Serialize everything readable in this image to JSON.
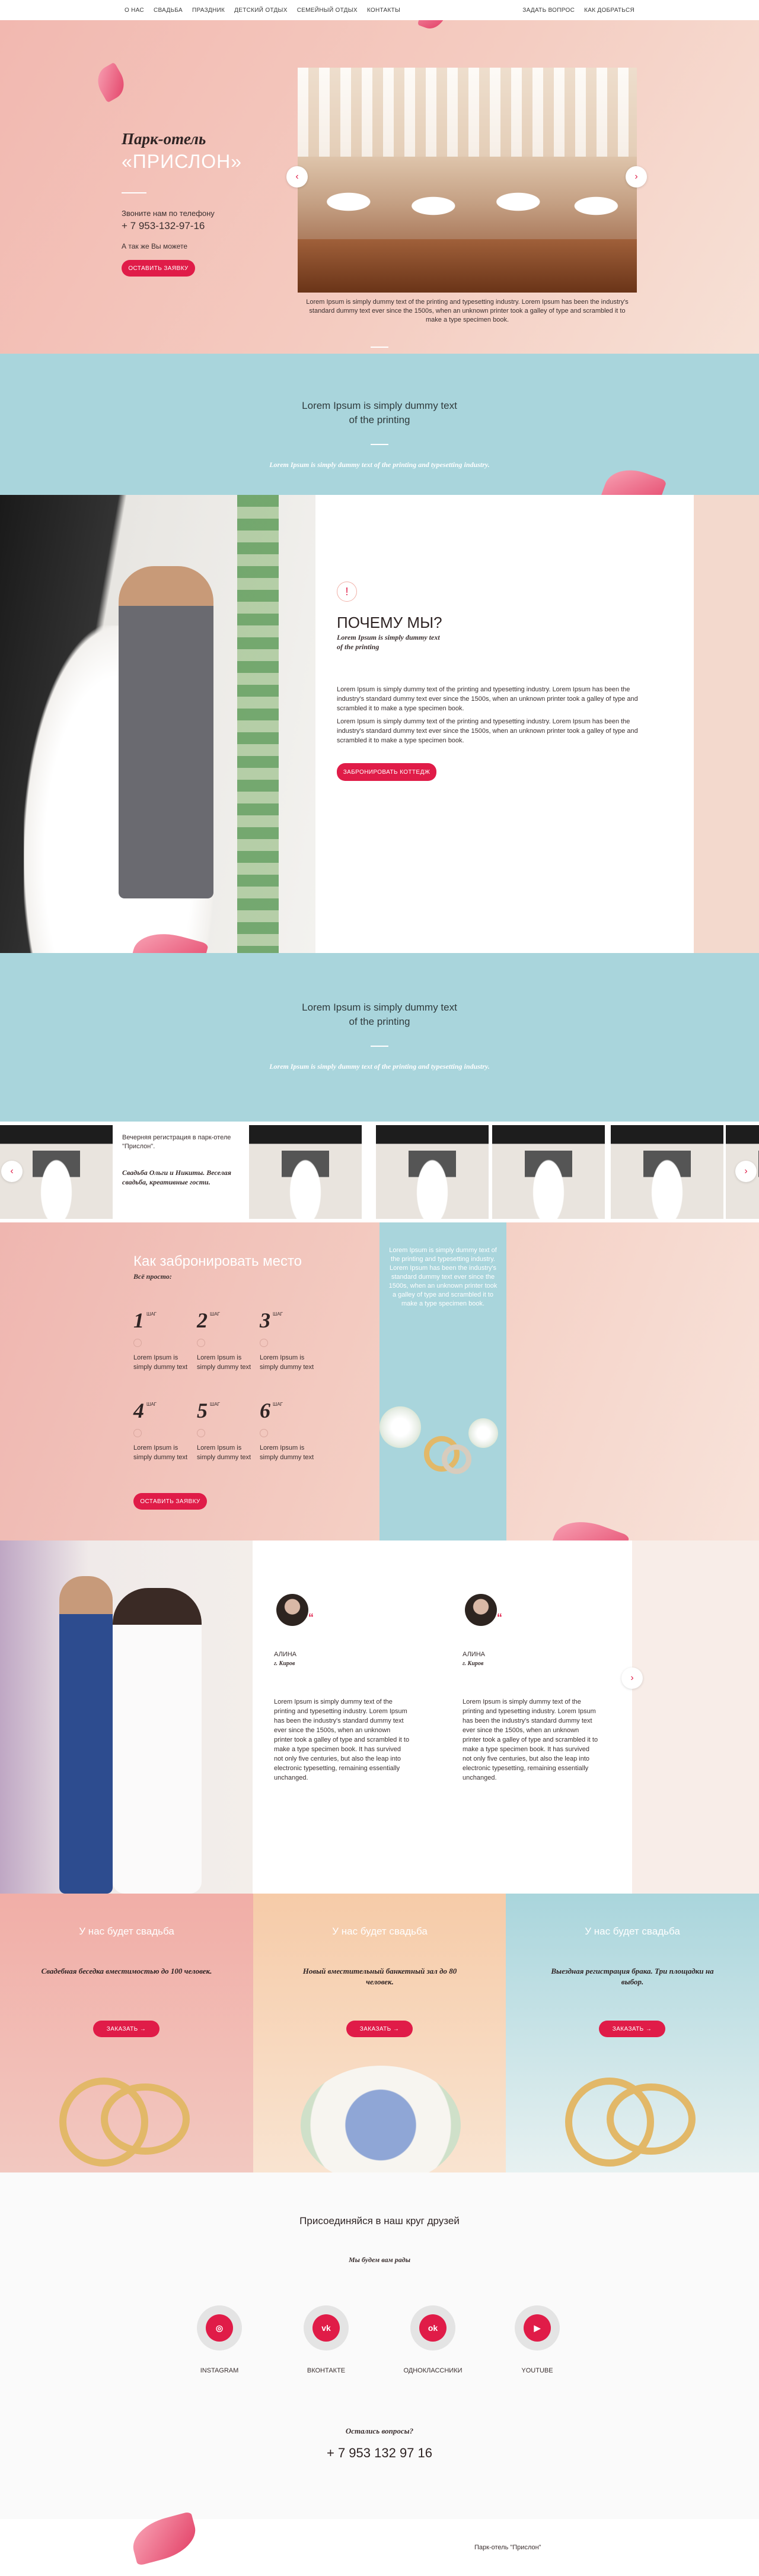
{
  "nav": {
    "left": [
      "О НАС",
      "СВАДЬБА",
      "ПРАЗДНИК",
      "ДЕТСКИЙ ОТДЫХ",
      "СЕМЕЙНЫЙ ОТДЫХ",
      "КОНТАКТЫ"
    ],
    "right": [
      "ЗАДАТЬ ВОПРОС",
      "КАК ДОБРАТЬСЯ"
    ]
  },
  "hero": {
    "title": "Парк-отель",
    "title2": "«ПРИСЛОН»",
    "call": "Звоните нам по телефону",
    "phone": "+ 7 953-132-97-16",
    "help": "А так же Вы можете",
    "button": "ОСТАВИТЬ ЗАЯВКУ",
    "caption": "Lorem Ipsum is simply dummy text of the printing and typesetting industry. Lorem Ipsum has been the industry's standard dummy text ever since the 1500s, when an unknown printer took a galley of type and scrambled it to make a type specimen book.",
    "prev": "‹",
    "next": "›"
  },
  "band1": {
    "title": "Lorem Ipsum is simply dummy text\nof the printing",
    "sub": "Lorem Ipsum is simply dummy text of the printing and typesetting industry."
  },
  "why": {
    "icon": "!",
    "title": "ПОЧЕМУ МЫ?",
    "sub": "Lorem Ipsum is simply dummy text\nof the printing",
    "p1": "Lorem Ipsum is simply dummy text of the printing and typesetting industry. Lorem Ipsum has been the industry's standard dummy text ever since the 1500s, when an unknown printer took a galley of type and scrambled it to make a type specimen book.",
    "p2": "Lorem Ipsum is simply dummy text of the printing and typesetting industry. Lorem Ipsum has been the industry's standard dummy text ever since the 1500s, when an unknown printer took a galley of type and scrambled it to make a type specimen book.",
    "button": "ЗАБРОНИРОВАТЬ КОТТЕДЖ"
  },
  "band2": {
    "title": "Lorem Ipsum is simply dummy text\nof the printing",
    "sub": "Lorem Ipsum is simply dummy text of the printing and typesetting industry."
  },
  "gallery": {
    "card_line1": "Вечерняя регистрация в парк-отеле \"Прислон\".",
    "card_line2": "Свадьба Ольги и Никиты. Веселая свадьба, креативные гости.",
    "prev": "‹",
    "next": "›"
  },
  "booking": {
    "title": "Как забронировать место",
    "sub": "Всё просто:",
    "step_label": "ШАГ",
    "steps": [
      {
        "n": "1",
        "text": "Lorem Ipsum is simply dummy text"
      },
      {
        "n": "2",
        "text": "Lorem Ipsum is simply dummy text"
      },
      {
        "n": "3",
        "text": "Lorem Ipsum is simply dummy text"
      },
      {
        "n": "4",
        "text": "Lorem Ipsum is simply dummy text"
      },
      {
        "n": "5",
        "text": "Lorem Ipsum is simply dummy text"
      },
      {
        "n": "6",
        "text": "Lorem Ipsum is simply dummy text"
      }
    ],
    "button": "ОСТАВИТЬ ЗАЯВКУ",
    "card_text": "Lorem Ipsum is simply dummy text of the printing and typesetting industry. Lorem Ipsum has been the industry's standard dummy text ever since the 1500s, when an unknown printer took a galley of type and scrambled it to make a type specimen book."
  },
  "reviews": {
    "items": [
      {
        "name": "АЛИНА",
        "city": "г. Киров",
        "text": "Lorem Ipsum is simply dummy text of the printing and typesetting industry. Lorem Ipsum has been the industry's standard dummy text ever since the 1500s, when an unknown printer took a galley of type and scrambled it to make a type specimen book. It has survived not only five centuries, but also the leap into electronic typesetting, remaining essentially unchanged."
      },
      {
        "name": "АЛИНА",
        "city": "г. Киров",
        "text": "Lorem Ipsum is simply dummy text of the printing and typesetting industry. Lorem Ipsum has been the industry's standard dummy text ever since the 1500s, when an unknown printer took a galley of type and scrambled it to make a type specimen book. It has survived not only five centuries, but also the leap into electronic typesetting, remaining essentially unchanged."
      }
    ],
    "next": "›"
  },
  "offers": [
    {
      "title": "У нас будет свадьба",
      "text": "Свадебная беседка вместимостью до 100 человек.",
      "button": "ЗАКАЗАТЬ  →"
    },
    {
      "title": "У нас будет свадьба",
      "text": "Новый вместительный банкетный зал до 80 человек.",
      "button": "ЗАКАЗАТЬ  →"
    },
    {
      "title": "У нас будет свадьба",
      "text": "Выездная регистрация брака. Три площадки на выбор.",
      "button": "ЗАКАЗАТЬ  →"
    }
  ],
  "social": {
    "title": "Присоединяйся в наш круг друзей",
    "sub": "Мы будем вам рады",
    "items": [
      {
        "label": "INSTAGRAM",
        "glyph": "◎",
        "icon": "instagram-icon"
      },
      {
        "label": "ВКОНТАКТЕ",
        "glyph": "vk",
        "icon": "vk-icon"
      },
      {
        "label": "ОДНОКЛАССНИКИ",
        "glyph": "ok",
        "icon": "odnoklassniki-icon"
      },
      {
        "label": "YOUTUBE",
        "glyph": "▶",
        "icon": "youtube-icon"
      }
    ],
    "question": "Остались вопросы?",
    "phone": "+ 7 953 132 97 16"
  },
  "footer": {
    "text": "Парк-отель \"Прислон\""
  },
  "colors": {
    "accent": "#e01c48",
    "teal": "#a9d5dc",
    "pink": "#f2b8b0",
    "peach": "#f5cda8"
  }
}
